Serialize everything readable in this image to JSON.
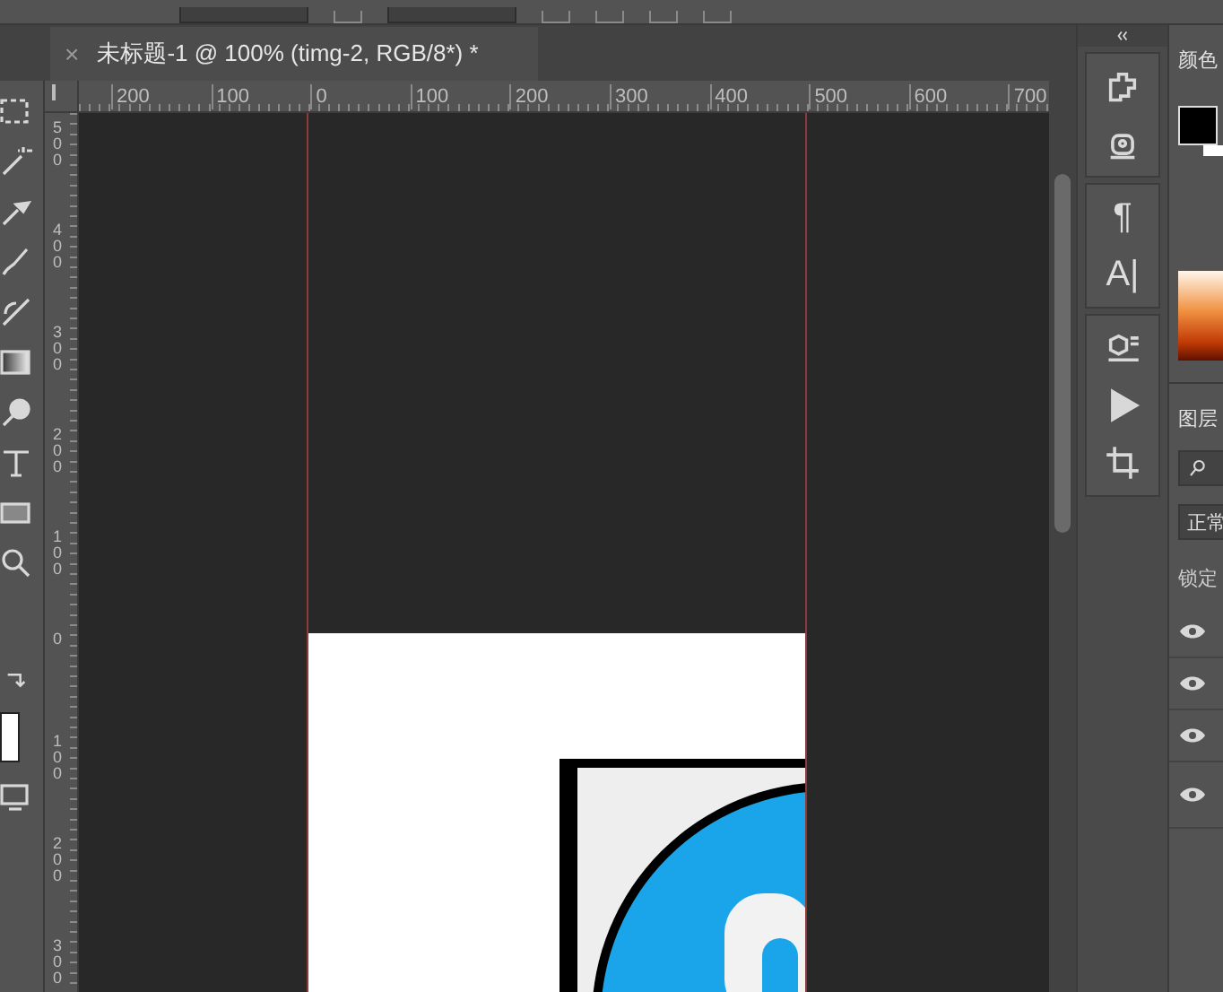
{
  "document_tab": {
    "close": "×",
    "title": "未标题-1 @ 100% (timg-2, RGB/8*) *"
  },
  "rulers": {
    "horizontal": [
      "200",
      "100",
      "0",
      "100",
      "200",
      "300",
      "400",
      "500",
      "600",
      "700"
    ],
    "vertical": [
      "500",
      "400",
      "300",
      "200",
      "100",
      "0",
      "100",
      "200",
      "300"
    ]
  },
  "panel_strip": {
    "paragraph": "¶",
    "character": "A|"
  },
  "color_panel": {
    "title": "颜色"
  },
  "layers_panel": {
    "title": "图层",
    "blend_mode": "正常",
    "lock_label": "锁定",
    "layers": [
      {
        "visible": true
      },
      {
        "visible": true
      },
      {
        "visible": true
      },
      {
        "visible": true
      }
    ]
  }
}
